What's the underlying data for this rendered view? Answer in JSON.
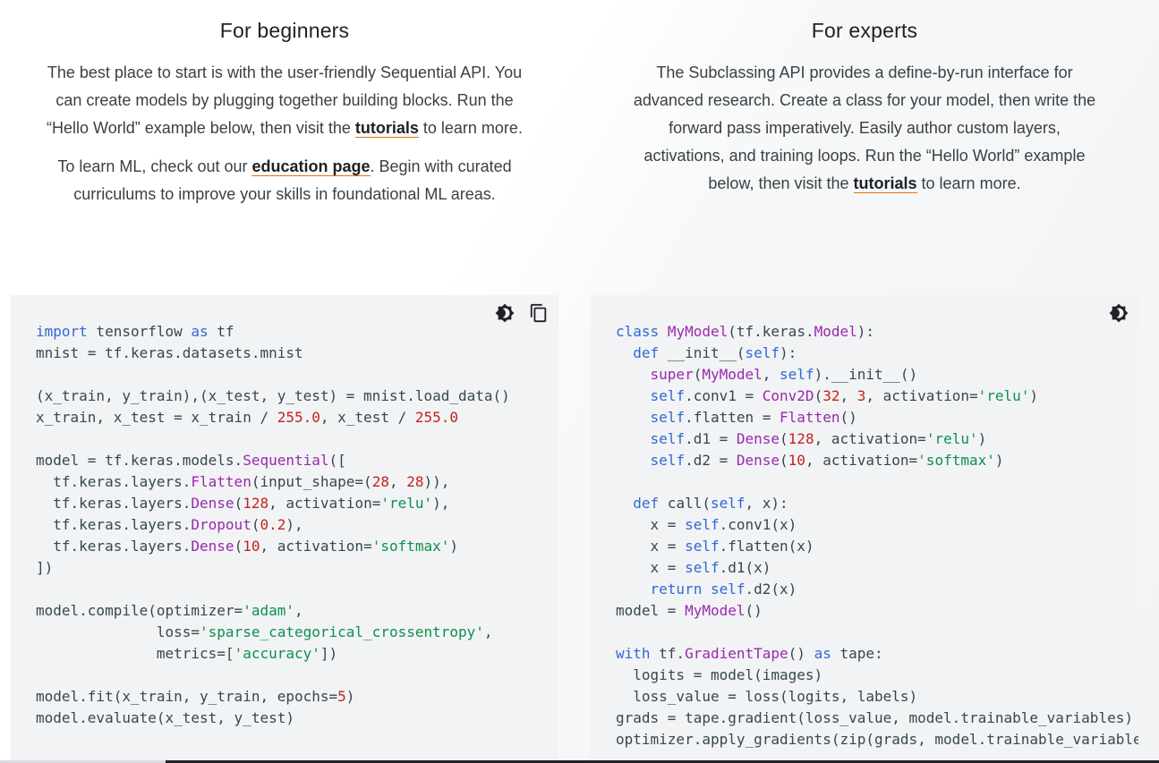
{
  "beginners": {
    "title": "For beginners",
    "para1_before": "The best place to start is with the user-friendly Sequential API. You can create models by plugging together building blocks. Run the “Hello World” example below, then visit the ",
    "para1_link": "tutorials",
    "para1_after": " to learn more.",
    "para2_before": "To learn ML, check out our ",
    "para2_link": "education page",
    "para2_after": ". Begin with curated curriculums to improve your skills in foundational ML areas."
  },
  "experts": {
    "title": "For experts",
    "para1_before": "The Subclassing API provides a define-by-run interface for advanced research. Create a class for your model, then write the forward pass imperatively. Easily author custom layers, activations, and training loops. Run the “Hello World” example below, then visit the ",
    "para1_link": "tutorials",
    "para1_after": " to learn more."
  },
  "code_beginners": {
    "theme_toggle_icon": "brightness-icon",
    "copy_icon": "copy-icon",
    "lines": [
      [
        [
          "kw",
          "import"
        ],
        [
          "t",
          " tensorflow "
        ],
        [
          "kw",
          "as"
        ],
        [
          "t",
          " tf"
        ]
      ],
      [
        [
          "t",
          "mnist = tf.keras.datasets.mnist"
        ]
      ],
      [],
      [
        [
          "t",
          "(x_train, y_train),(x_test, y_test) = mnist.load_data()"
        ]
      ],
      [
        [
          "t",
          "x_train, x_test = x_train / "
        ],
        [
          "num",
          "255.0"
        ],
        [
          "t",
          ", x_test / "
        ],
        [
          "num",
          "255.0"
        ]
      ],
      [],
      [
        [
          "t",
          "model = tf.keras.models."
        ],
        [
          "fn",
          "Sequential"
        ],
        [
          "t",
          "(["
        ]
      ],
      [
        [
          "t",
          "  tf.keras.layers."
        ],
        [
          "fn",
          "Flatten"
        ],
        [
          "t",
          "(input_shape=("
        ],
        [
          "num",
          "28"
        ],
        [
          "t",
          ", "
        ],
        [
          "num",
          "28"
        ],
        [
          "t",
          ")),"
        ]
      ],
      [
        [
          "t",
          "  tf.keras.layers."
        ],
        [
          "fn",
          "Dense"
        ],
        [
          "t",
          "("
        ],
        [
          "num",
          "128"
        ],
        [
          "t",
          ", activation="
        ],
        [
          "str",
          "'relu'"
        ],
        [
          "t",
          "),"
        ]
      ],
      [
        [
          "t",
          "  tf.keras.layers."
        ],
        [
          "fn",
          "Dropout"
        ],
        [
          "t",
          "("
        ],
        [
          "num",
          "0.2"
        ],
        [
          "t",
          "),"
        ]
      ],
      [
        [
          "t",
          "  tf.keras.layers."
        ],
        [
          "fn",
          "Dense"
        ],
        [
          "t",
          "("
        ],
        [
          "num",
          "10"
        ],
        [
          "t",
          ", activation="
        ],
        [
          "str",
          "'softmax'"
        ],
        [
          "t",
          ")"
        ]
      ],
      [
        [
          "t",
          "])"
        ]
      ],
      [],
      [
        [
          "t",
          "model.compile(optimizer="
        ],
        [
          "str",
          "'adam'"
        ],
        [
          "t",
          ","
        ]
      ],
      [
        [
          "t",
          "              loss="
        ],
        [
          "str",
          "'sparse_categorical_crossentropy'"
        ],
        [
          "t",
          ","
        ]
      ],
      [
        [
          "t",
          "              metrics=["
        ],
        [
          "str",
          "'accuracy'"
        ],
        [
          "t",
          "])"
        ]
      ],
      [],
      [
        [
          "t",
          "model.fit(x_train, y_train, epochs="
        ],
        [
          "num",
          "5"
        ],
        [
          "t",
          ")"
        ]
      ],
      [
        [
          "t",
          "model.evaluate(x_test, y_test)"
        ]
      ]
    ]
  },
  "code_experts": {
    "theme_toggle_icon": "brightness-icon",
    "lines": [
      [
        [
          "kw",
          "class"
        ],
        [
          "t",
          " "
        ],
        [
          "fn",
          "MyModel"
        ],
        [
          "t",
          "(tf.keras."
        ],
        [
          "fn",
          "Model"
        ],
        [
          "t",
          "):"
        ]
      ],
      [
        [
          "t",
          "  "
        ],
        [
          "kw",
          "def"
        ],
        [
          "t",
          " __init__("
        ],
        [
          "kw",
          "self"
        ],
        [
          "t",
          "):"
        ]
      ],
      [
        [
          "t",
          "    "
        ],
        [
          "fn",
          "super"
        ],
        [
          "t",
          "("
        ],
        [
          "fn",
          "MyModel"
        ],
        [
          "t",
          ", "
        ],
        [
          "kw",
          "self"
        ],
        [
          "t",
          ").__init__()"
        ]
      ],
      [
        [
          "t",
          "    "
        ],
        [
          "kw",
          "self"
        ],
        [
          "t",
          ".conv1 = "
        ],
        [
          "fn",
          "Conv2D"
        ],
        [
          "t",
          "("
        ],
        [
          "num",
          "32"
        ],
        [
          "t",
          ", "
        ],
        [
          "num",
          "3"
        ],
        [
          "t",
          ", activation="
        ],
        [
          "str",
          "'relu'"
        ],
        [
          "t",
          ")"
        ]
      ],
      [
        [
          "t",
          "    "
        ],
        [
          "kw",
          "self"
        ],
        [
          "t",
          ".flatten = "
        ],
        [
          "fn",
          "Flatten"
        ],
        [
          "t",
          "()"
        ]
      ],
      [
        [
          "t",
          "    "
        ],
        [
          "kw",
          "self"
        ],
        [
          "t",
          ".d1 = "
        ],
        [
          "fn",
          "Dense"
        ],
        [
          "t",
          "("
        ],
        [
          "num",
          "128"
        ],
        [
          "t",
          ", activation="
        ],
        [
          "str",
          "'relu'"
        ],
        [
          "t",
          ")"
        ]
      ],
      [
        [
          "t",
          "    "
        ],
        [
          "kw",
          "self"
        ],
        [
          "t",
          ".d2 = "
        ],
        [
          "fn",
          "Dense"
        ],
        [
          "t",
          "("
        ],
        [
          "num",
          "10"
        ],
        [
          "t",
          ", activation="
        ],
        [
          "str",
          "'softmax'"
        ],
        [
          "t",
          ")"
        ]
      ],
      [],
      [
        [
          "t",
          "  "
        ],
        [
          "kw",
          "def"
        ],
        [
          "t",
          " call("
        ],
        [
          "kw",
          "self"
        ],
        [
          "t",
          ", x):"
        ]
      ],
      [
        [
          "t",
          "    x = "
        ],
        [
          "kw",
          "self"
        ],
        [
          "t",
          ".conv1(x)"
        ]
      ],
      [
        [
          "t",
          "    x = "
        ],
        [
          "kw",
          "self"
        ],
        [
          "t",
          ".flatten(x)"
        ]
      ],
      [
        [
          "t",
          "    x = "
        ],
        [
          "kw",
          "self"
        ],
        [
          "t",
          ".d1(x)"
        ]
      ],
      [
        [
          "t",
          "    "
        ],
        [
          "kw",
          "return"
        ],
        [
          "t",
          " "
        ],
        [
          "kw",
          "self"
        ],
        [
          "t",
          ".d2(x)"
        ]
      ],
      [
        [
          "t",
          "model = "
        ],
        [
          "fn",
          "MyModel"
        ],
        [
          "t",
          "()"
        ]
      ],
      [],
      [
        [
          "kw",
          "with"
        ],
        [
          "t",
          " tf."
        ],
        [
          "fn",
          "GradientTape"
        ],
        [
          "t",
          "() "
        ],
        [
          "kw",
          "as"
        ],
        [
          "t",
          " tape:"
        ]
      ],
      [
        [
          "t",
          "  logits = model(images)"
        ]
      ],
      [
        [
          "t",
          "  loss_value = loss(logits, labels)"
        ]
      ],
      [
        [
          "t",
          "grads = tape.gradient(loss_value, model.trainable_variables)"
        ]
      ],
      [
        [
          "t",
          "optimizer.apply_gradients(zip(grads, model.trainable_variables))"
        ]
      ]
    ]
  }
}
